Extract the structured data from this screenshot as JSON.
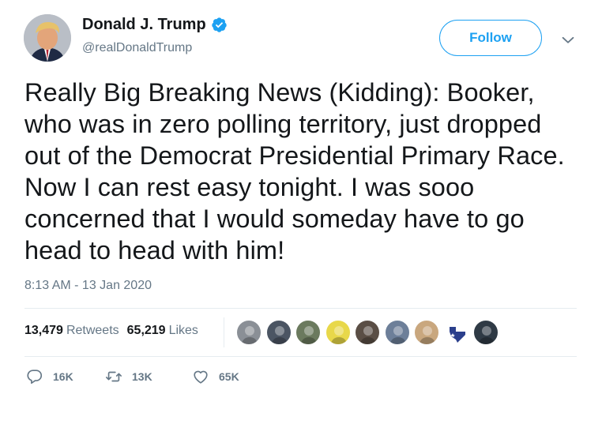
{
  "author": {
    "display_name": "Donald J. Trump",
    "handle": "@realDonaldTrump",
    "verified_icon": "verified-badge-icon"
  },
  "follow_label": "Follow",
  "tweet": {
    "text": "Really Big Breaking News (Kidding): Booker, who was in zero polling territory, just dropped out of the Democrat Presidential Primary Race. Now I can rest easy tonight. I was sooo concerned that I would someday have to go head to head with him!",
    "timestamp": "8:13 AM - 13 Jan 2020"
  },
  "stats": {
    "retweets_count": "13,479",
    "retweets_label": "Retweets",
    "likes_count": "65,219",
    "likes_label": "Likes"
  },
  "likers": [
    {
      "icon": "liker-avatar",
      "color": "#8a8f96"
    },
    {
      "icon": "liker-avatar",
      "color": "#4b5563"
    },
    {
      "icon": "liker-avatar",
      "color": "#6b7a5e"
    },
    {
      "icon": "liker-avatar",
      "color": "#e8d84a"
    },
    {
      "icon": "liker-avatar",
      "color": "#5a4e45"
    },
    {
      "icon": "liker-avatar",
      "color": "#6d7f99"
    },
    {
      "icon": "liker-avatar",
      "color": "#c9a77e"
    },
    {
      "icon": "texas-flag-avatar",
      "color": "#2b3f8c"
    },
    {
      "icon": "liker-avatar",
      "color": "#2f3a45"
    }
  ],
  "actions": {
    "reply": {
      "icon": "reply-icon",
      "count": "16K"
    },
    "retweet": {
      "icon": "retweet-icon",
      "count": "13K"
    },
    "like": {
      "icon": "heart-icon",
      "count": "65K"
    }
  },
  "colors": {
    "accent": "#1da1f2",
    "secondary_text": "#657786",
    "primary_text": "#14171a",
    "divider": "#e6ecf0"
  }
}
